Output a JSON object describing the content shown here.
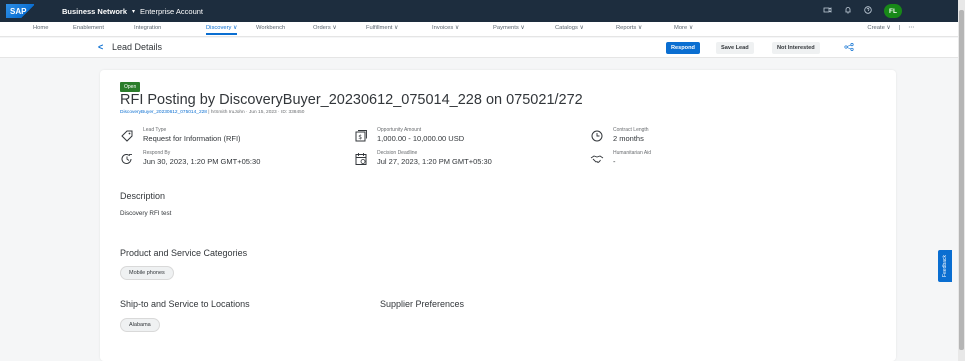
{
  "shell": {
    "logo": "SAP",
    "title": "Business Network",
    "caret": "▾",
    "subtitle": "Enterprise Account",
    "avatar_initials": "FL"
  },
  "nav": {
    "items": [
      {
        "label": "Home"
      },
      {
        "label": "Enablement"
      },
      {
        "label": "Integration"
      },
      {
        "label": "Discovery ∨"
      },
      {
        "label": "Workbench"
      },
      {
        "label": "Orders ∨"
      },
      {
        "label": "Fulfillment ∨"
      },
      {
        "label": "Invoices ∨"
      },
      {
        "label": "Payments ∨"
      },
      {
        "label": "Catalogs ∨"
      },
      {
        "label": "Reports ∨"
      },
      {
        "label": "More ∨"
      }
    ],
    "create_label": "Create ∨",
    "more_label": "⋯"
  },
  "header": {
    "back": "<",
    "title": "Lead Details",
    "respond_label": "Respond",
    "save_label": "Save Lead",
    "not_interested_label": "Not Interested"
  },
  "lead": {
    "status": "Open",
    "title": "RFI Posting by DiscoveryBuyer_20230612_075014_228 on 075021/272",
    "buyer_link": "DiscoveryBuyer_20230612_075014_228",
    "meta": " | hrSmith IruJohn · Jun 15, 2023 · ID: 338450",
    "fields": {
      "lead_type": {
        "label": "Lead Type",
        "value": "Request for Information (RFI)"
      },
      "opportunity_amount": {
        "label": "Opportunity Amount",
        "value": "1,000.00 - 10,000.00 USD"
      },
      "contract_length": {
        "label": "Contract Length",
        "value": "2 months"
      },
      "respond_by": {
        "label": "Respond By",
        "value": "Jun 30, 2023, 1:20 PM GMT+05:30"
      },
      "decision_deadline": {
        "label": "Decision Deadline",
        "value": "Jul 27, 2023, 1:20 PM GMT+05:30"
      },
      "humanitarian_aid": {
        "label": "Humanitarian Aid",
        "value": "-"
      }
    },
    "description_title": "Description",
    "description_text": "Discovery RFI test",
    "categories_title": "Product and Service Categories",
    "categories": [
      "Mobile phones"
    ],
    "locations_title": "Ship-to and Service to Locations",
    "locations": [
      "Alabama"
    ],
    "supplier_pref_title": "Supplier Preferences"
  },
  "feedback_label": "Feedback",
  "colors": {
    "shell": "#1d2d3e",
    "accent": "#0a6ed1",
    "status_open": "#2b7d2b",
    "avatar": "#188918"
  },
  "icons": {
    "lead_type": "tag-icon",
    "opportunity_amount": "money-bills-icon",
    "contract_length": "clock-icon",
    "respond_by": "timer-icon",
    "decision_deadline": "calendar-icon",
    "humanitarian_aid": "handshake-icon"
  }
}
